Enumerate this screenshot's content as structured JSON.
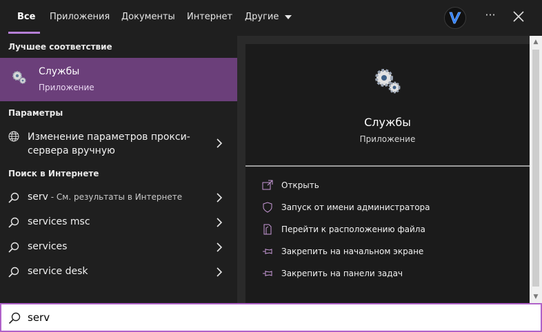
{
  "tabs": [
    {
      "label": "Все"
    },
    {
      "label": "Приложения"
    },
    {
      "label": "Документы"
    },
    {
      "label": "Интернет"
    },
    {
      "label": "Другие"
    }
  ],
  "accent_color": "#b57fd6",
  "left": {
    "best_match_heading": "Лучшее соответствие",
    "best_match": {
      "title": "Службы",
      "subtitle": "Приложение",
      "icon": "gear-icon"
    },
    "settings_heading": "Параметры",
    "settings_item": {
      "line1": "Изменение параметров прокси-",
      "line2": "сервера вручную",
      "icon": "globe-icon"
    },
    "web_heading": "Поиск в Интернете",
    "web_items": [
      {
        "query": "serv",
        "suffix": " - См. результаты в Интернете"
      },
      {
        "query": "services msc"
      },
      {
        "query": "services"
      },
      {
        "query": "service desk"
      }
    ]
  },
  "preview": {
    "title": "Службы",
    "subtitle": "Приложение",
    "actions": [
      {
        "label": "Открыть",
        "icon": "open-icon"
      },
      {
        "label": "Запуск от имени администратора",
        "icon": "shield-icon"
      },
      {
        "label": "Перейти к расположению файла",
        "icon": "folder-icon"
      },
      {
        "label": "Закрепить на начальном экране",
        "icon": "pin-icon"
      },
      {
        "label": "Закрепить на панели задач",
        "icon": "pin-icon"
      }
    ]
  },
  "search": {
    "value": "serv"
  }
}
